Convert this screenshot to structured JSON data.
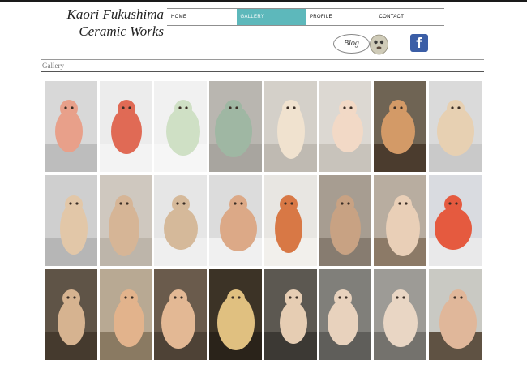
{
  "site": {
    "title_line1": "Kaori Fukushima",
    "title_line2": "Ceramic Works"
  },
  "nav": {
    "items": [
      {
        "label": "HOME",
        "active": false
      },
      {
        "label": "GALLERY",
        "active": true
      },
      {
        "label": "PROFILE",
        "active": false
      },
      {
        "label": "CONTACT",
        "active": false
      }
    ],
    "accent_color": "#5db8bb"
  },
  "social": {
    "blog_label": "Blog",
    "facebook_glyph": "f",
    "facebook_color": "#3b5ea6"
  },
  "page": {
    "title": "Gallery"
  },
  "gallery": {
    "columns": 8,
    "rows": 3,
    "thumbnails": [
      {
        "subject": "pink faces with red-rimmed eyes",
        "bg": "#d8d8d8",
        "fg": "#e8a08a",
        "floor": "#bdbdbd"
      },
      {
        "subject": "red faces on white",
        "bg": "#ececec",
        "fg": "#e06a55",
        "floor": "#f3f3f3"
      },
      {
        "subject": "white mesh-textured face",
        "bg": "#f1f1f1",
        "fg": "#cfe0c5",
        "floor": "#f6f6f6"
      },
      {
        "subject": "green mosaic head",
        "bg": "#b9b6b0",
        "fg": "#9fb7a3",
        "floor": "#a8a59f"
      },
      {
        "subject": "figure with beak in vessel",
        "bg": "#d4d0c9",
        "fg": "#f0e2cf",
        "floor": "#bfbab2"
      },
      {
        "subject": "two dolls",
        "bg": "#dcd8d2",
        "fg": "#f2d9c6",
        "floor": "#c8c3bb"
      },
      {
        "subject": "dolls on table by window",
        "bg": "#6f6454",
        "fg": "#d39a67",
        "floor": "#4b3c2e"
      },
      {
        "subject": "layered body figure",
        "bg": "#dadada",
        "fg": "#e7d0b2",
        "floor": "#c9c9c9"
      },
      {
        "subject": "stacked-ring figure",
        "bg": "#cfcfcf",
        "fg": "#e2c7a8",
        "floor": "#b6b6b6"
      },
      {
        "subject": "seated chubby figure",
        "bg": "#cfc8bf",
        "fg": "#d6b596",
        "floor": "#bdb5aa"
      },
      {
        "subject": "grid-pattern face",
        "bg": "#e6e6e6",
        "fg": "#d5b99a",
        "floor": "#efefef"
      },
      {
        "subject": "round face in doorway",
        "bg": "#dcdcdc",
        "fg": "#dca987",
        "floor": "#f0f0f0"
      },
      {
        "subject": "patterned small heads",
        "bg": "#e8e6e2",
        "fg": "#d87845",
        "floor": "#f2f0ec"
      },
      {
        "subject": "pair of figures",
        "bg": "#a79d91",
        "fg": "#c8a283",
        "floor": "#877c70"
      },
      {
        "subject": "reclining figure",
        "bg": "#b8ada0",
        "fg": "#e9cfb7",
        "floor": "#8c7a67"
      },
      {
        "subject": "painted matryoshka",
        "bg": "#d9dbe0",
        "fg": "#e55a3f",
        "floor": "#e9e9ea"
      },
      {
        "subject": "sitting figure dark room",
        "bg": "#5f5447",
        "fg": "#d6b390",
        "floor": "#453a2e"
      },
      {
        "subject": "figure on stand",
        "bg": "#b8a993",
        "fg": "#e2b38c",
        "floor": "#8a7a62"
      },
      {
        "subject": "seated figure with face",
        "bg": "#6a5b4c",
        "fg": "#e3b894",
        "floor": "#4e4236"
      },
      {
        "subject": "figure under lamp",
        "bg": "#3c3326",
        "fg": "#e0c080",
        "floor": "#2a231a"
      },
      {
        "subject": "reclining figures on floor",
        "bg": "#5c5851",
        "fg": "#e6cdb3",
        "floor": "#3c3934"
      },
      {
        "subject": "torso sculpture",
        "bg": "#807f7a",
        "fg": "#e8d2bd",
        "floor": "#5f5e5a"
      },
      {
        "subject": "upside-down figure",
        "bg": "#9d9b96",
        "fg": "#e9d6c4",
        "floor": "#74726d"
      },
      {
        "subject": "figures by window",
        "bg": "#c9c9c3",
        "fg": "#e0b79a",
        "floor": "#5f5243"
      }
    ]
  }
}
